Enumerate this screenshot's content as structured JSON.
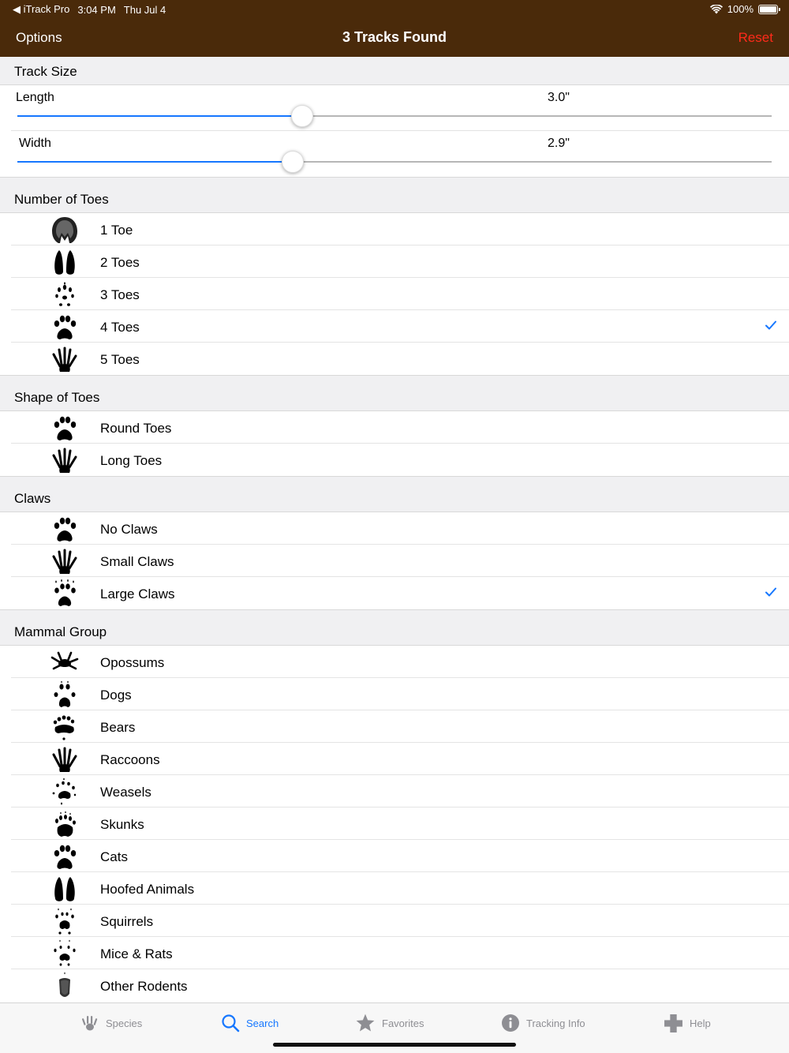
{
  "status": {
    "back_app": "iTrack Pro",
    "time": "3:04 PM",
    "date": "Thu Jul 4",
    "battery": "100%"
  },
  "nav": {
    "left": "Options",
    "title": "3 Tracks Found",
    "right": "Reset"
  },
  "colors": {
    "nav_bg": "#4a2a0a",
    "accent": "#1677ff",
    "reset": "#ff2a1a"
  },
  "track_size": {
    "header": "Track Size",
    "length": {
      "label": "Length",
      "value": "3.0\"",
      "fraction": 0.378
    },
    "width": {
      "label": "Width",
      "value": "2.9\"",
      "fraction": 0.365
    }
  },
  "number_of_toes": {
    "header": "Number of Toes",
    "items": [
      {
        "label": "1 Toe",
        "icon": "hoof-one-toe-icon",
        "checked": false
      },
      {
        "label": "2 Toes",
        "icon": "hoof-two-toes-icon",
        "checked": false
      },
      {
        "label": "3 Toes",
        "icon": "three-toes-track-icon",
        "checked": false
      },
      {
        "label": "4 Toes",
        "icon": "four-toes-paw-icon",
        "checked": true
      },
      {
        "label": "5 Toes",
        "icon": "five-toes-hand-icon",
        "checked": false
      }
    ]
  },
  "shape_of_toes": {
    "header": "Shape of Toes",
    "items": [
      {
        "label": "Round Toes",
        "icon": "round-toes-paw-icon",
        "checked": false
      },
      {
        "label": "Long Toes",
        "icon": "long-toes-hand-icon",
        "checked": false
      }
    ]
  },
  "claws": {
    "header": "Claws",
    "items": [
      {
        "label": "No Claws",
        "icon": "paw-no-claws-icon",
        "checked": false
      },
      {
        "label": "Small Claws",
        "icon": "hand-small-claws-icon",
        "checked": false
      },
      {
        "label": "Large Claws",
        "icon": "paw-large-claws-icon",
        "checked": true
      }
    ]
  },
  "mammal_group": {
    "header": "Mammal Group",
    "items": [
      {
        "label": "Opossums",
        "icon": "opossum-track-icon"
      },
      {
        "label": "Dogs",
        "icon": "dog-track-icon"
      },
      {
        "label": "Bears",
        "icon": "bear-track-icon"
      },
      {
        "label": "Raccoons",
        "icon": "raccoon-track-icon"
      },
      {
        "label": "Weasels",
        "icon": "weasel-track-icon"
      },
      {
        "label": "Skunks",
        "icon": "skunk-track-icon"
      },
      {
        "label": "Cats",
        "icon": "cat-track-icon"
      },
      {
        "label": "Hoofed Animals",
        "icon": "hoof-track-icon"
      },
      {
        "label": "Squirrels",
        "icon": "squirrel-track-icon"
      },
      {
        "label": "Mice & Rats",
        "icon": "mouse-track-icon"
      },
      {
        "label": "Other Rodents",
        "icon": "rodent-track-icon"
      }
    ]
  },
  "tabs": [
    {
      "label": "Species",
      "icon": "paw-species-icon",
      "active": false
    },
    {
      "label": "Search",
      "icon": "search-icon",
      "active": true
    },
    {
      "label": "Favorites",
      "icon": "star-icon",
      "active": false
    },
    {
      "label": "Tracking Info",
      "icon": "info-icon",
      "active": false
    },
    {
      "label": "Help",
      "icon": "plus-help-icon",
      "active": false
    }
  ]
}
